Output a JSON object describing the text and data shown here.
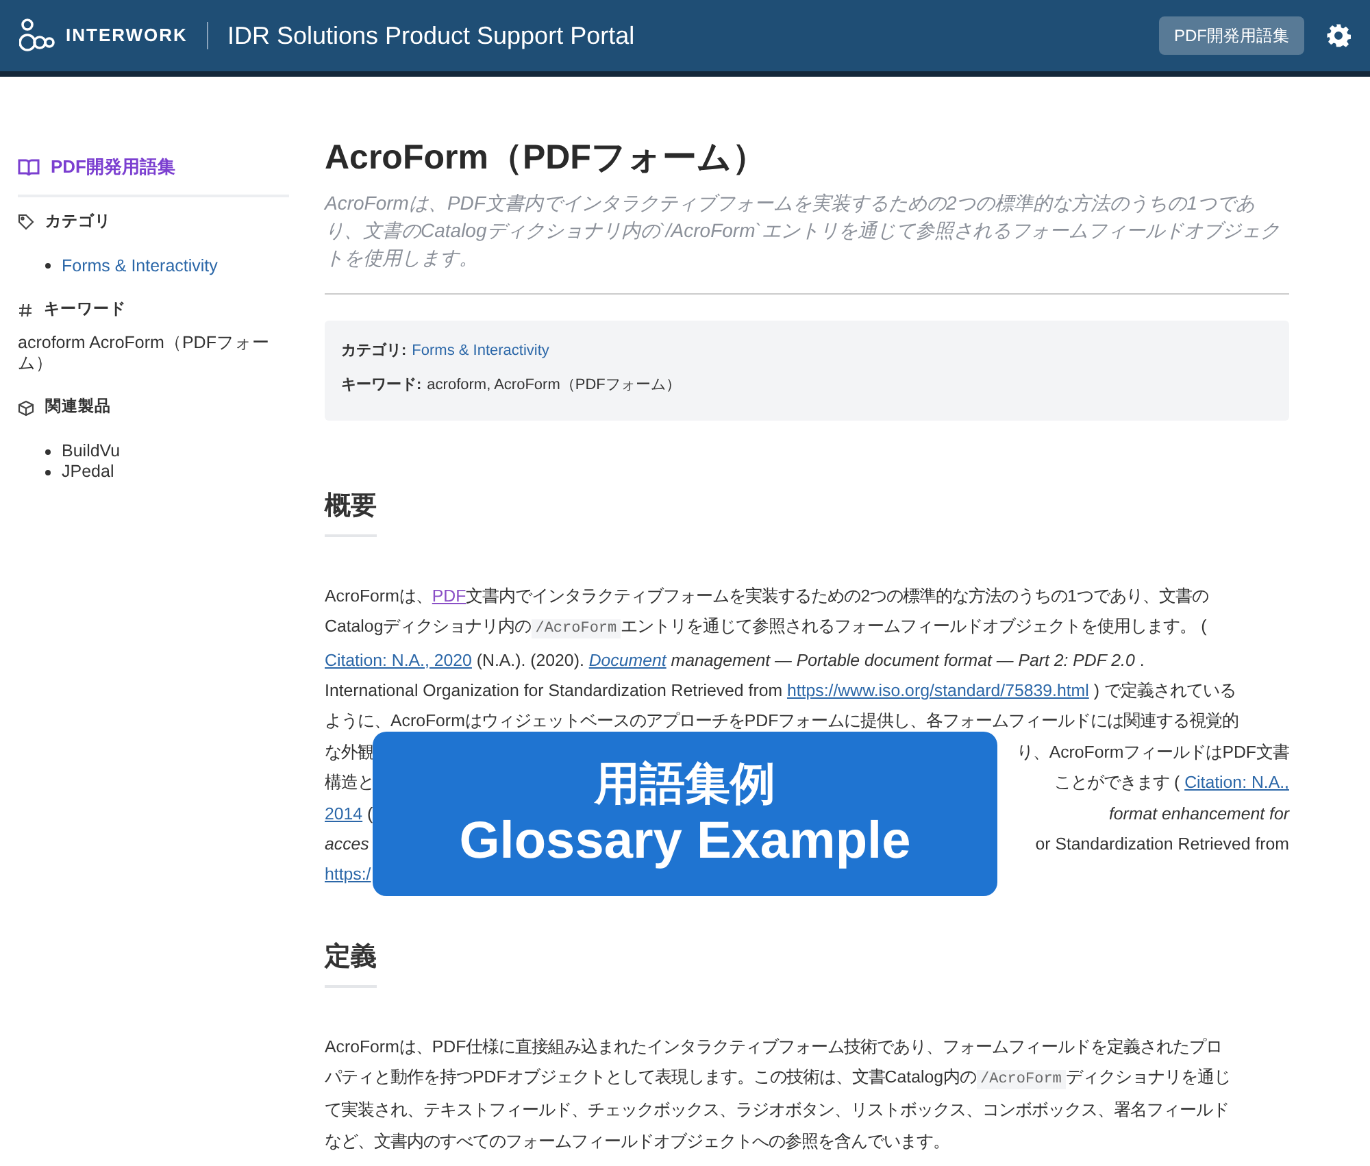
{
  "header": {
    "logo_text": "INTERWORK",
    "portal_title": "IDR Solutions Product Support Portal",
    "nav_button": "PDF開発用語集"
  },
  "sidebar": {
    "glossary_link": "PDF開発用語集",
    "sections": [
      {
        "kind": "category",
        "heading": "カテゴリ",
        "items": [
          "Forms & Interactivity"
        ]
      },
      {
        "kind": "keywords",
        "heading": "キーワード",
        "text": "acroform AcroForm（PDFフォーム）"
      },
      {
        "kind": "products",
        "heading": "関連製品",
        "items": [
          "BuildVu",
          "JPedal"
        ]
      }
    ]
  },
  "main": {
    "title": "AcroForm（PDFフォーム）",
    "summary": "AcroFormは、PDF文書内でインタラクティブフォームを実装するための2つの標準的な方法のうちの1つであり、文書のCatalogディクショナリ内の`/AcroForm`エントリを通じて参照されるフォームフィールドオブジェクトを使用します。",
    "meta": [
      {
        "label": "カテゴリ:",
        "value": "Forms & Interactivity",
        "kind": "link"
      },
      {
        "label": "キーワード:",
        "value": "acroform, AcroForm（PDFフォーム）",
        "kind": "text"
      }
    ],
    "sections": [
      {
        "heading": "概要",
        "overlay": {
          "title": "用語集例",
          "subtitle": "Glossary Example"
        },
        "lines": [
          {
            "left": [
              {
                "kind": "text",
                "text": "AcroFormは、"
              },
              {
                "kind": "visited_link",
                "text": "PDF"
              },
              {
                "kind": "text",
                "text": "文書内でインタラクティブフォームを実装するための2つの標準的な方法のうちの1つであり、文書の"
              }
            ]
          },
          {
            "left": [
              {
                "kind": "text",
                "text": "Catalogディクショナリ内の"
              },
              {
                "kind": "code",
                "text": "/AcroForm"
              },
              {
                "kind": "text",
                "text": "エントリを通じて参照されるフォームフィールドオブジェクトを使用します。 ("
              }
            ]
          },
          {
            "left": [
              {
                "kind": "link",
                "text": "Citation: N.A., 2020"
              },
              {
                "kind": "text",
                "text": " (N.A.). (2020). "
              },
              {
                "kind": "italic_link",
                "text": "Document"
              },
              {
                "kind": "italic",
                "text": " management — Portable document format — Part 2: PDF 2.0"
              },
              {
                "kind": "text",
                "text": " ."
              }
            ]
          },
          {
            "left": [
              {
                "kind": "text",
                "text": "International Organization for Standardization Retrieved from "
              },
              {
                "kind": "link",
                "text": "https://www.iso.org/standard/75839.html"
              },
              {
                "kind": "text",
                "text": " ) で定義されている"
              }
            ]
          },
          {
            "left": [
              {
                "kind": "text",
                "text": "ように、AcroFormはウィジェットベースのアプローチをPDFフォームに提供し、各フォームフィールドには関連する視覚的"
              }
            ]
          },
          {
            "left": [
              {
                "kind": "text",
                "text": "な外観"
              }
            ],
            "right": [
              {
                "kind": "text",
                "text": "り、AcroFormフィールドはPDF文書"
              }
            ]
          },
          {
            "left": [
              {
                "kind": "text",
                "text": "構造と"
              }
            ],
            "right": [
              {
                "kind": "text",
                "text": "ことができます ( "
              },
              {
                "kind": "link",
                "text": "Citation: N.A.,"
              }
            ]
          },
          {
            "left": [
              {
                "kind": "link",
                "text": "2014"
              },
              {
                "kind": "text",
                "text": " ("
              }
            ],
            "right": [
              {
                "kind": "italic",
                "text": "format enhancement for"
              }
            ]
          },
          {
            "left": [
              {
                "kind": "italic",
                "text": "acces"
              }
            ],
            "right": [
              {
                "kind": "text",
                "text": "or Standardization Retrieved from"
              }
            ]
          },
          {
            "left": [
              {
                "kind": "link",
                "text": "https:/"
              }
            ]
          }
        ]
      },
      {
        "heading": "定義",
        "lines": [
          {
            "left": [
              {
                "kind": "text",
                "text": "AcroFormは、PDF仕様に直接組み込まれたインタラクティブフォーム技術であり、フォームフィールドを定義されたプロ"
              }
            ]
          },
          {
            "left": [
              {
                "kind": "text",
                "text": "パティと動作を持つPDFオブジェクトとして表現します。この技術は、文書Catalog内の"
              },
              {
                "kind": "code",
                "text": "/AcroForm"
              },
              {
                "kind": "text",
                "text": "ディクショナリを通じ"
              }
            ]
          },
          {
            "left": [
              {
                "kind": "text",
                "text": "て実装され、テキストフィールド、チェックボックス、ラジオボタン、リストボックス、コンボボックス、署名フィールド"
              }
            ]
          },
          {
            "left": [
              {
                "kind": "text",
                "text": "など、文書内のすべてのフォームフィールドオブジェクトへの参照を含んでいます。"
              }
            ]
          }
        ]
      }
    ]
  }
}
